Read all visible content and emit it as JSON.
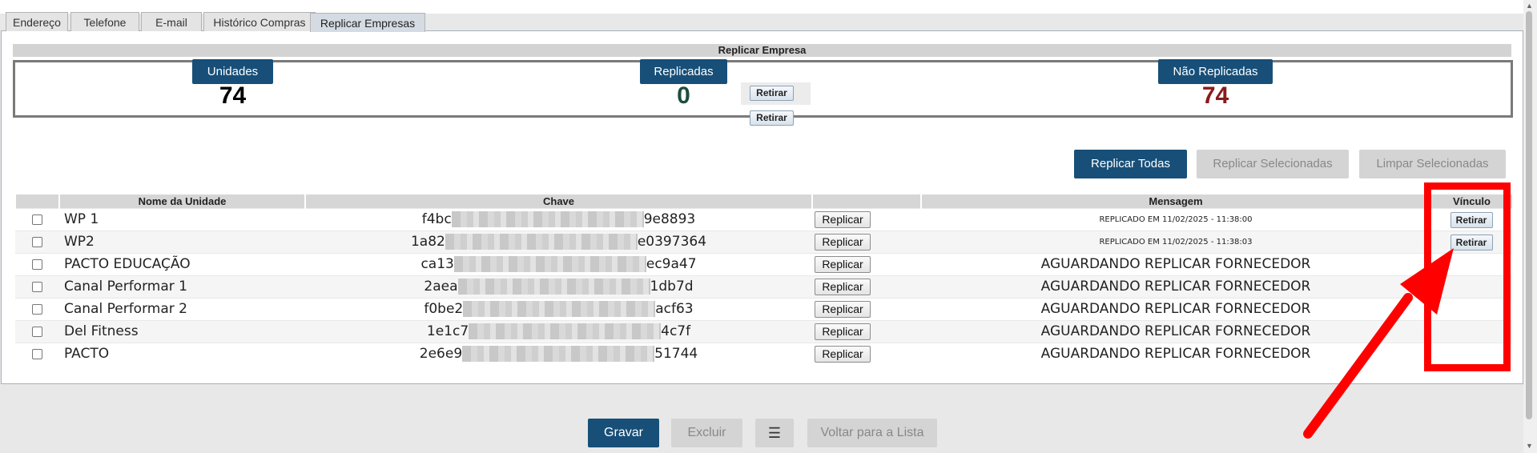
{
  "tabs": [
    {
      "label": "Endereço",
      "active": false
    },
    {
      "label": "Telefone",
      "active": false
    },
    {
      "label": "E-mail",
      "active": false
    },
    {
      "label": "Histórico Compras",
      "active": false
    },
    {
      "label": "Replicar Empresas",
      "active": true
    }
  ],
  "section_title": "Replicar Empresa",
  "summary": {
    "units_label": "Unidades",
    "units_value": "74",
    "replicated_label": "Replicadas",
    "replicated_value": "0",
    "not_replicated_label": "Não Replicadas",
    "not_replicated_value": "74",
    "retirar_top": "Retirar",
    "retirar_bottom": "Retirar"
  },
  "actions": {
    "replicate_all": "Replicar Todas",
    "replicate_selected": "Replicar Selecionadas",
    "clear_selected": "Limpar Selecionadas"
  },
  "table": {
    "headers": [
      "",
      "Nome da Unidade",
      "Chave",
      "",
      "Mensagem",
      "Vínculo"
    ],
    "replicate_label": "Replicar",
    "unlink_label": "Retirar",
    "rows": [
      {
        "name": "WP 1",
        "key_start": "f4bc",
        "key_end": "9e8893",
        "message": "REPLICADO EM 11/02/2025 - 11:38:00",
        "message_small": true,
        "has_unlink": true
      },
      {
        "name": "WP2",
        "key_start": "1a82",
        "key_end": "e0397364",
        "message": "REPLICADO EM 11/02/2025 - 11:38:03",
        "message_small": true,
        "has_unlink": true
      },
      {
        "name": "PACTO EDUCAÇÃO",
        "key_start": "ca13",
        "key_end": "ec9a47",
        "message": "AGUARDANDO REPLICAR FORNECEDOR",
        "message_small": false,
        "has_unlink": false
      },
      {
        "name": "Canal Performar 1",
        "key_start": "2aea",
        "key_end": "1db7d",
        "message": "AGUARDANDO REPLICAR FORNECEDOR",
        "message_small": false,
        "has_unlink": false
      },
      {
        "name": "Canal Performar 2",
        "key_start": "f0be2",
        "key_end": "acf63",
        "message": "AGUARDANDO REPLICAR FORNECEDOR",
        "message_small": false,
        "has_unlink": false
      },
      {
        "name": "Del Fitness",
        "key_start": "1e1c7",
        "key_end": "4c7f",
        "message": "AGUARDANDO REPLICAR FORNECEDOR",
        "message_small": false,
        "has_unlink": false
      },
      {
        "name": "PACTO",
        "key_start": "2e6e9",
        "key_end": "51744",
        "message": "AGUARDANDO REPLICAR FORNECEDOR",
        "message_small": false,
        "has_unlink": false
      }
    ]
  },
  "bottom": {
    "save": "Gravar",
    "delete": "Excluir",
    "list_icon": "list-icon",
    "back": "Voltar para a Lista"
  },
  "colors": {
    "primary": "#174f78",
    "replicated_value": "#1d4d3c",
    "not_replicated_value": "#8b1a1a",
    "highlight": "#ff0000"
  }
}
